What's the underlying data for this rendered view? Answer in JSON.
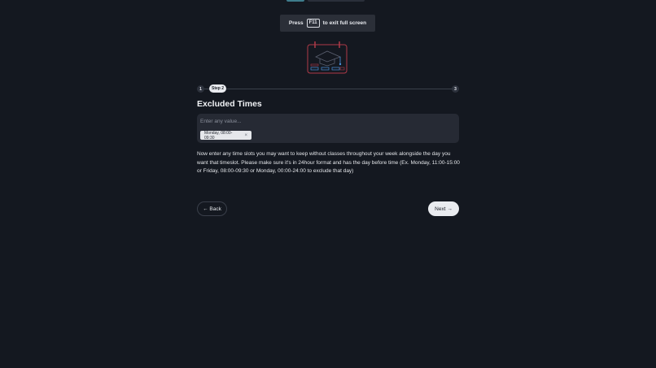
{
  "banner": {
    "prefix": "Press",
    "key": "F11",
    "suffix": "to exit full screen"
  },
  "illustration": {
    "icon": "calendar-illustration"
  },
  "stepper": {
    "first_step": "1",
    "current_step_label": "Step 2",
    "last_step": "3"
  },
  "section": {
    "title": "Excluded Times"
  },
  "input": {
    "placeholder": "Enter any value...",
    "chips": [
      {
        "label": "Monday, 08:00-09:30",
        "remove": "×"
      }
    ]
  },
  "description": "Now enter any time slots you may want to keep without classes throughout your week alongside the day you want that timeslot. Please make sure it's in 24hour format and has the day before time (Ex. Monday, 11:00-15:00 or Friday, 08:00-09:30 or Monday, 00:00-24:00 to exclude that day)",
  "nav": {
    "back_label": "← Back",
    "next_label": "Next →"
  },
  "colors": {
    "background": "#141820",
    "accent": "#3e7c8c",
    "illustration_red": "#b03a48",
    "illustration_blue": "#4a90d9"
  }
}
